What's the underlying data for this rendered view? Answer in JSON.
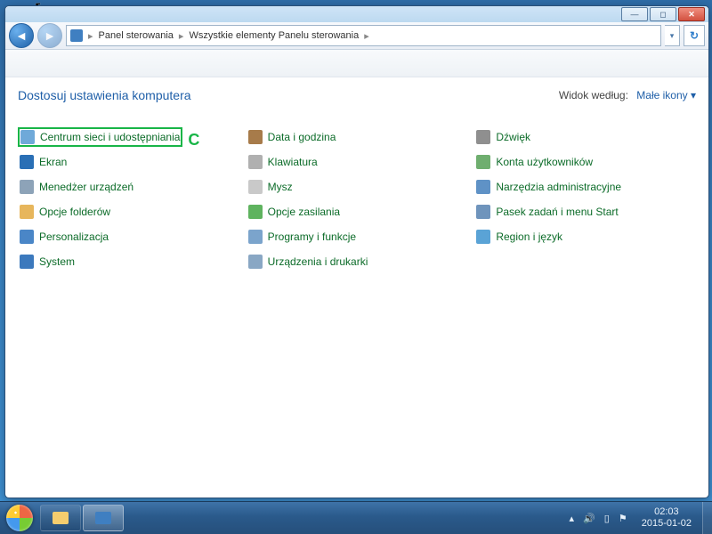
{
  "window_controls": {
    "min": "—",
    "max": "◻",
    "close": "✕"
  },
  "breadcrumb": {
    "root": "Panel sterowania",
    "current": "Wszystkie elementy Panelu sterowania"
  },
  "header": {
    "title": "Dostosuj ustawienia komputera",
    "view_label": "Widok według:",
    "view_value": "Małe ikony ▾"
  },
  "items": {
    "col1": [
      {
        "label": "Centrum sieci i udostępniania",
        "highlighted": true,
        "letter": "C"
      },
      {
        "label": "Ekran"
      },
      {
        "label": "Menedżer urządzeń"
      },
      {
        "label": "Opcje folderów"
      },
      {
        "label": "Personalizacja"
      },
      {
        "label": "System"
      }
    ],
    "col2": [
      {
        "label": "Data i godzina"
      },
      {
        "label": "Klawiatura"
      },
      {
        "label": "Mysz"
      },
      {
        "label": "Opcje zasilania"
      },
      {
        "label": "Programy i funkcje"
      },
      {
        "label": "Urządzenia i drukarki"
      }
    ],
    "col3": [
      {
        "label": "Dźwięk"
      },
      {
        "label": "Konta użytkowników"
      },
      {
        "label": "Narzędzia administracyjne"
      },
      {
        "label": "Pasek zadań i menu Start"
      },
      {
        "label": "Region i język"
      }
    ]
  },
  "tray": {
    "up": "▴",
    "vol": "🔊",
    "net": "▯",
    "batt": "⚑",
    "time": "02:03",
    "date": "2015-01-02"
  }
}
